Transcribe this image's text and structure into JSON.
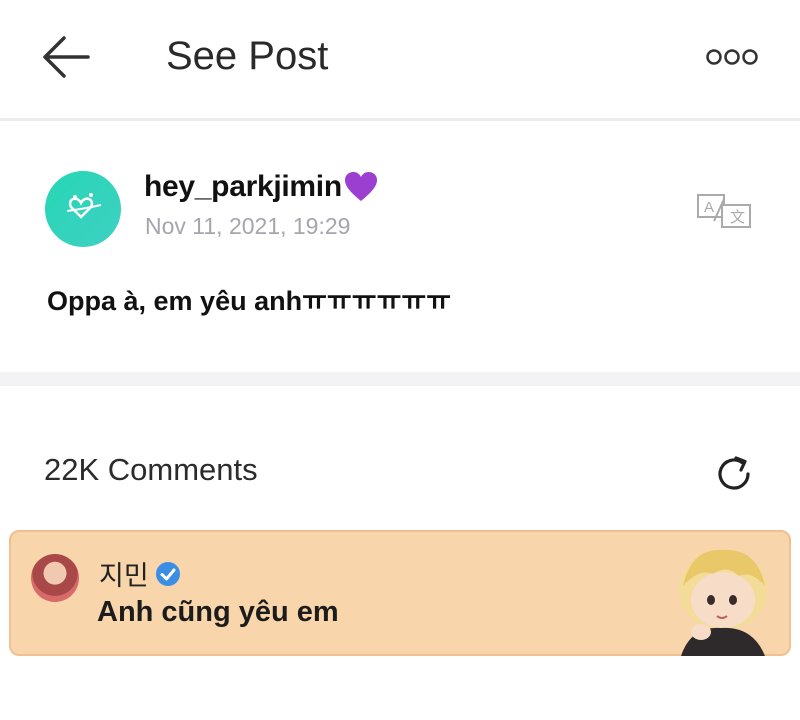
{
  "header": {
    "title": "See Post",
    "back_icon": "arrow-left-icon",
    "more_icon": "more-dots-icon"
  },
  "post": {
    "username": "hey_parkjimin",
    "username_emoji": "purple-heart-icon",
    "date": "Nov 11, 2021, 19:29",
    "text": "Oppa à, em yêu anhㅠㅠㅠㅠㅠㅠ",
    "translate_icon": "translate-icon"
  },
  "comments": {
    "count_label": "22K Comments",
    "refresh_icon": "refresh-icon",
    "items": [
      {
        "author": "지민",
        "verified": true,
        "text": "Anh cũng yêu em",
        "highlight_color": "#f9d5ab"
      }
    ]
  },
  "colors": {
    "accent": "#2ad3b7",
    "verified": "#3a8ee6",
    "highlight": "#f9d5ab"
  }
}
